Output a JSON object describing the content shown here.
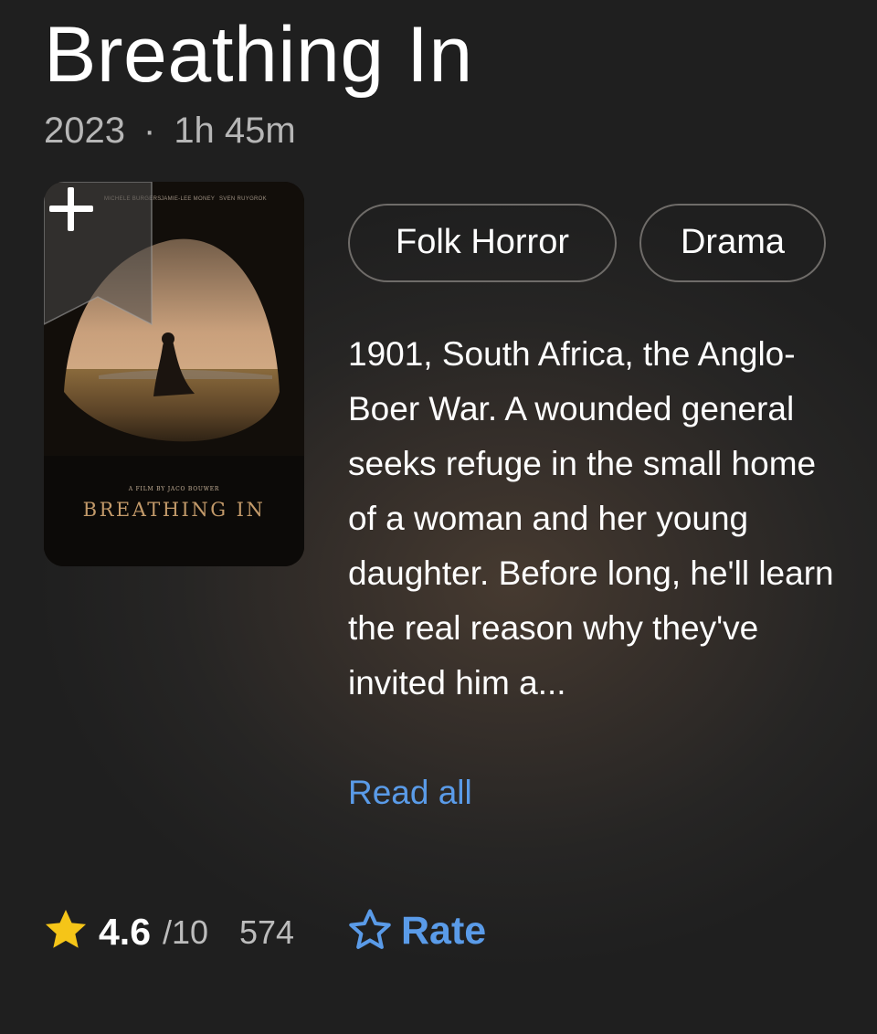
{
  "title": "Breathing In",
  "meta": {
    "year": "2023",
    "separator": "·",
    "runtime": "1h 45m"
  },
  "poster": {
    "credits": [
      "MICHELE BURGERS",
      "JAMIE-LEE MONEY",
      "SVEN RUYGROK"
    ],
    "byline": "A FILM BY JACO BOUWER",
    "title": "BREATHING IN",
    "add_icon": "plus-icon"
  },
  "genres": [
    "Folk Horror",
    "Drama"
  ],
  "plot": "1901, South Africa, the Anglo-Boer War. A wounded general seeks refuge in the small home of a woman and her young daughter. Before long, he'll learn the real reason why they've invited him a...",
  "read_all_label": "Read all",
  "rating": {
    "value": "4.6",
    "max": "/10",
    "count": "574",
    "icon": "star-icon"
  },
  "rate": {
    "label": "Rate",
    "icon": "star-outline-icon"
  },
  "colors": {
    "accent": "#5a9be8",
    "star": "#f5c518",
    "chip_border": "#6f6c69"
  }
}
